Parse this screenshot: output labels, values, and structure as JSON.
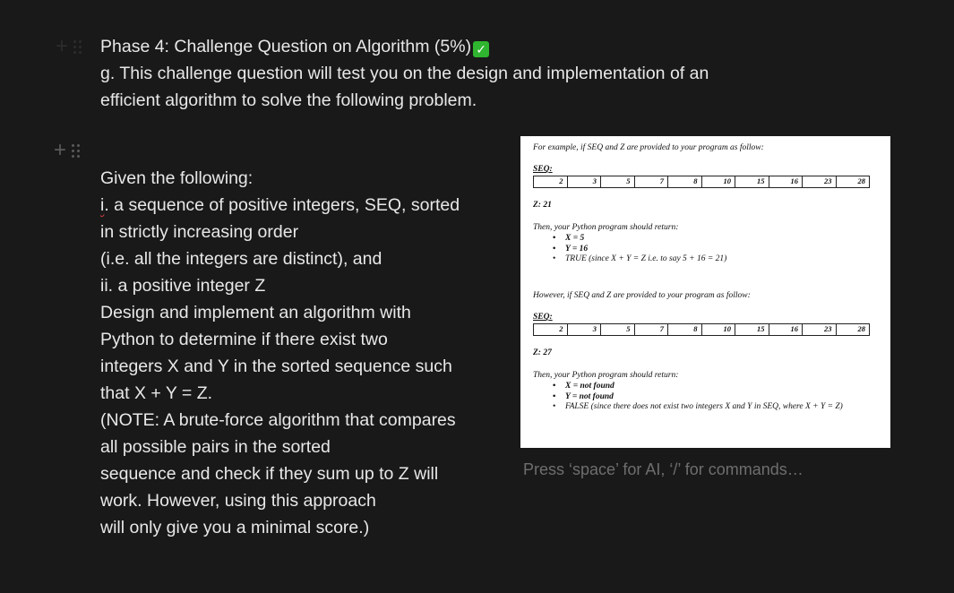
{
  "heading": {
    "text": "Phase 4: Challenge Question on Algorithm (5%)"
  },
  "intro": {
    "text": "g. This challenge question will test you on the design and implementation of an efficient algorithm to solve the following problem."
  },
  "left": {
    "lines": [
      "Given the following:",
      "i. a sequence of positive integers, SEQ, sorted",
      "in strictly increasing order",
      "(i.e. all the integers are distinct), and",
      "ii. a positive integer Z",
      "Design and implement an algorithm with",
      "Python to determine if there exist two",
      "integers X and Y in the sorted sequence such",
      "that X + Y = Z.",
      "(NOTE: A brute-force algorithm that compares",
      "all possible pairs in the sorted",
      "sequence and check if they sum up to Z will",
      "work. However, using this approach",
      "will only give you a minimal score.)"
    ]
  },
  "doc": {
    "ex1_intro": "For example, if SEQ and Z are provided to your program as follow:",
    "seq_label": "SEQ:",
    "seq": [
      "2",
      "3",
      "5",
      "7",
      "8",
      "10",
      "15",
      "16",
      "23",
      "28"
    ],
    "z1": "Z: 21",
    "ret1": "Then, your Python program should return:",
    "ret1_items": [
      "X = 5",
      "Y = 16",
      "TRUE (since X + Y = Z i.e. to say  5 + 16 = 21)"
    ],
    "ex2_intro": "However, if SEQ and Z are provided to your program as follow:",
    "z2": "Z: 27",
    "ret2": "Then, your Python program should return:",
    "ret2_items": [
      "X = not found",
      "Y = not found",
      "FALSE (since there does not exist two integers X and Y in SEQ, where  X + Y = Z)"
    ]
  },
  "placeholder": "Press ‘space’ for AI, ‘/’ for commands…"
}
